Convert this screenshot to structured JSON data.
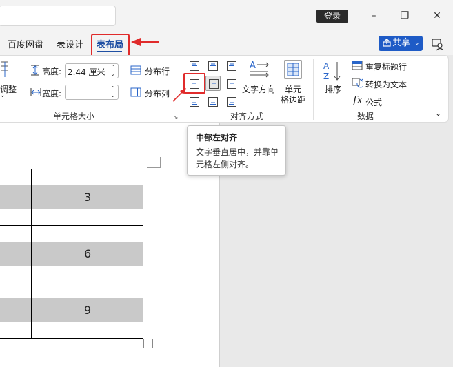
{
  "titlebar": {
    "login_label": "登录",
    "minimize_glyph": "–",
    "restore_glyph": "❐",
    "close_glyph": "✕"
  },
  "tabs": [
    {
      "label": "百度网盘",
      "active": false
    },
    {
      "label": "表设计",
      "active": false
    },
    {
      "label": "表布局",
      "active": true
    }
  ],
  "share": {
    "label": "共享",
    "dropdown": "⌄"
  },
  "ribbon": {
    "autofit_label": "调整",
    "cell_size": {
      "height_label": "高度:",
      "height_value": "2.44 厘米",
      "width_label": "宽度:",
      "width_value": "",
      "distribute_rows": "分布行",
      "distribute_cols": "分布列",
      "group_label": "单元格大小"
    },
    "alignment": {
      "text_direction": "文字方向",
      "cell_margins_line1": "单元",
      "cell_margins_line2": "格边距",
      "group_label": "对齐方式"
    },
    "data": {
      "sort": "排序",
      "repeat_header": "重复标题行",
      "convert_to_text": "转换为文本",
      "formula": "公式",
      "group_label": "数据"
    }
  },
  "tooltip": {
    "title": "中部左对齐",
    "description": "文字垂直居中，并靠单元格左侧对齐。"
  },
  "table": {
    "values": [
      "3",
      "6",
      "9"
    ]
  },
  "colors": {
    "accent_blue": "#1f4fa3",
    "share_blue": "#1e5bc6",
    "highlight_red": "#e02b2b",
    "cell_shade": "#c9c9c9"
  }
}
